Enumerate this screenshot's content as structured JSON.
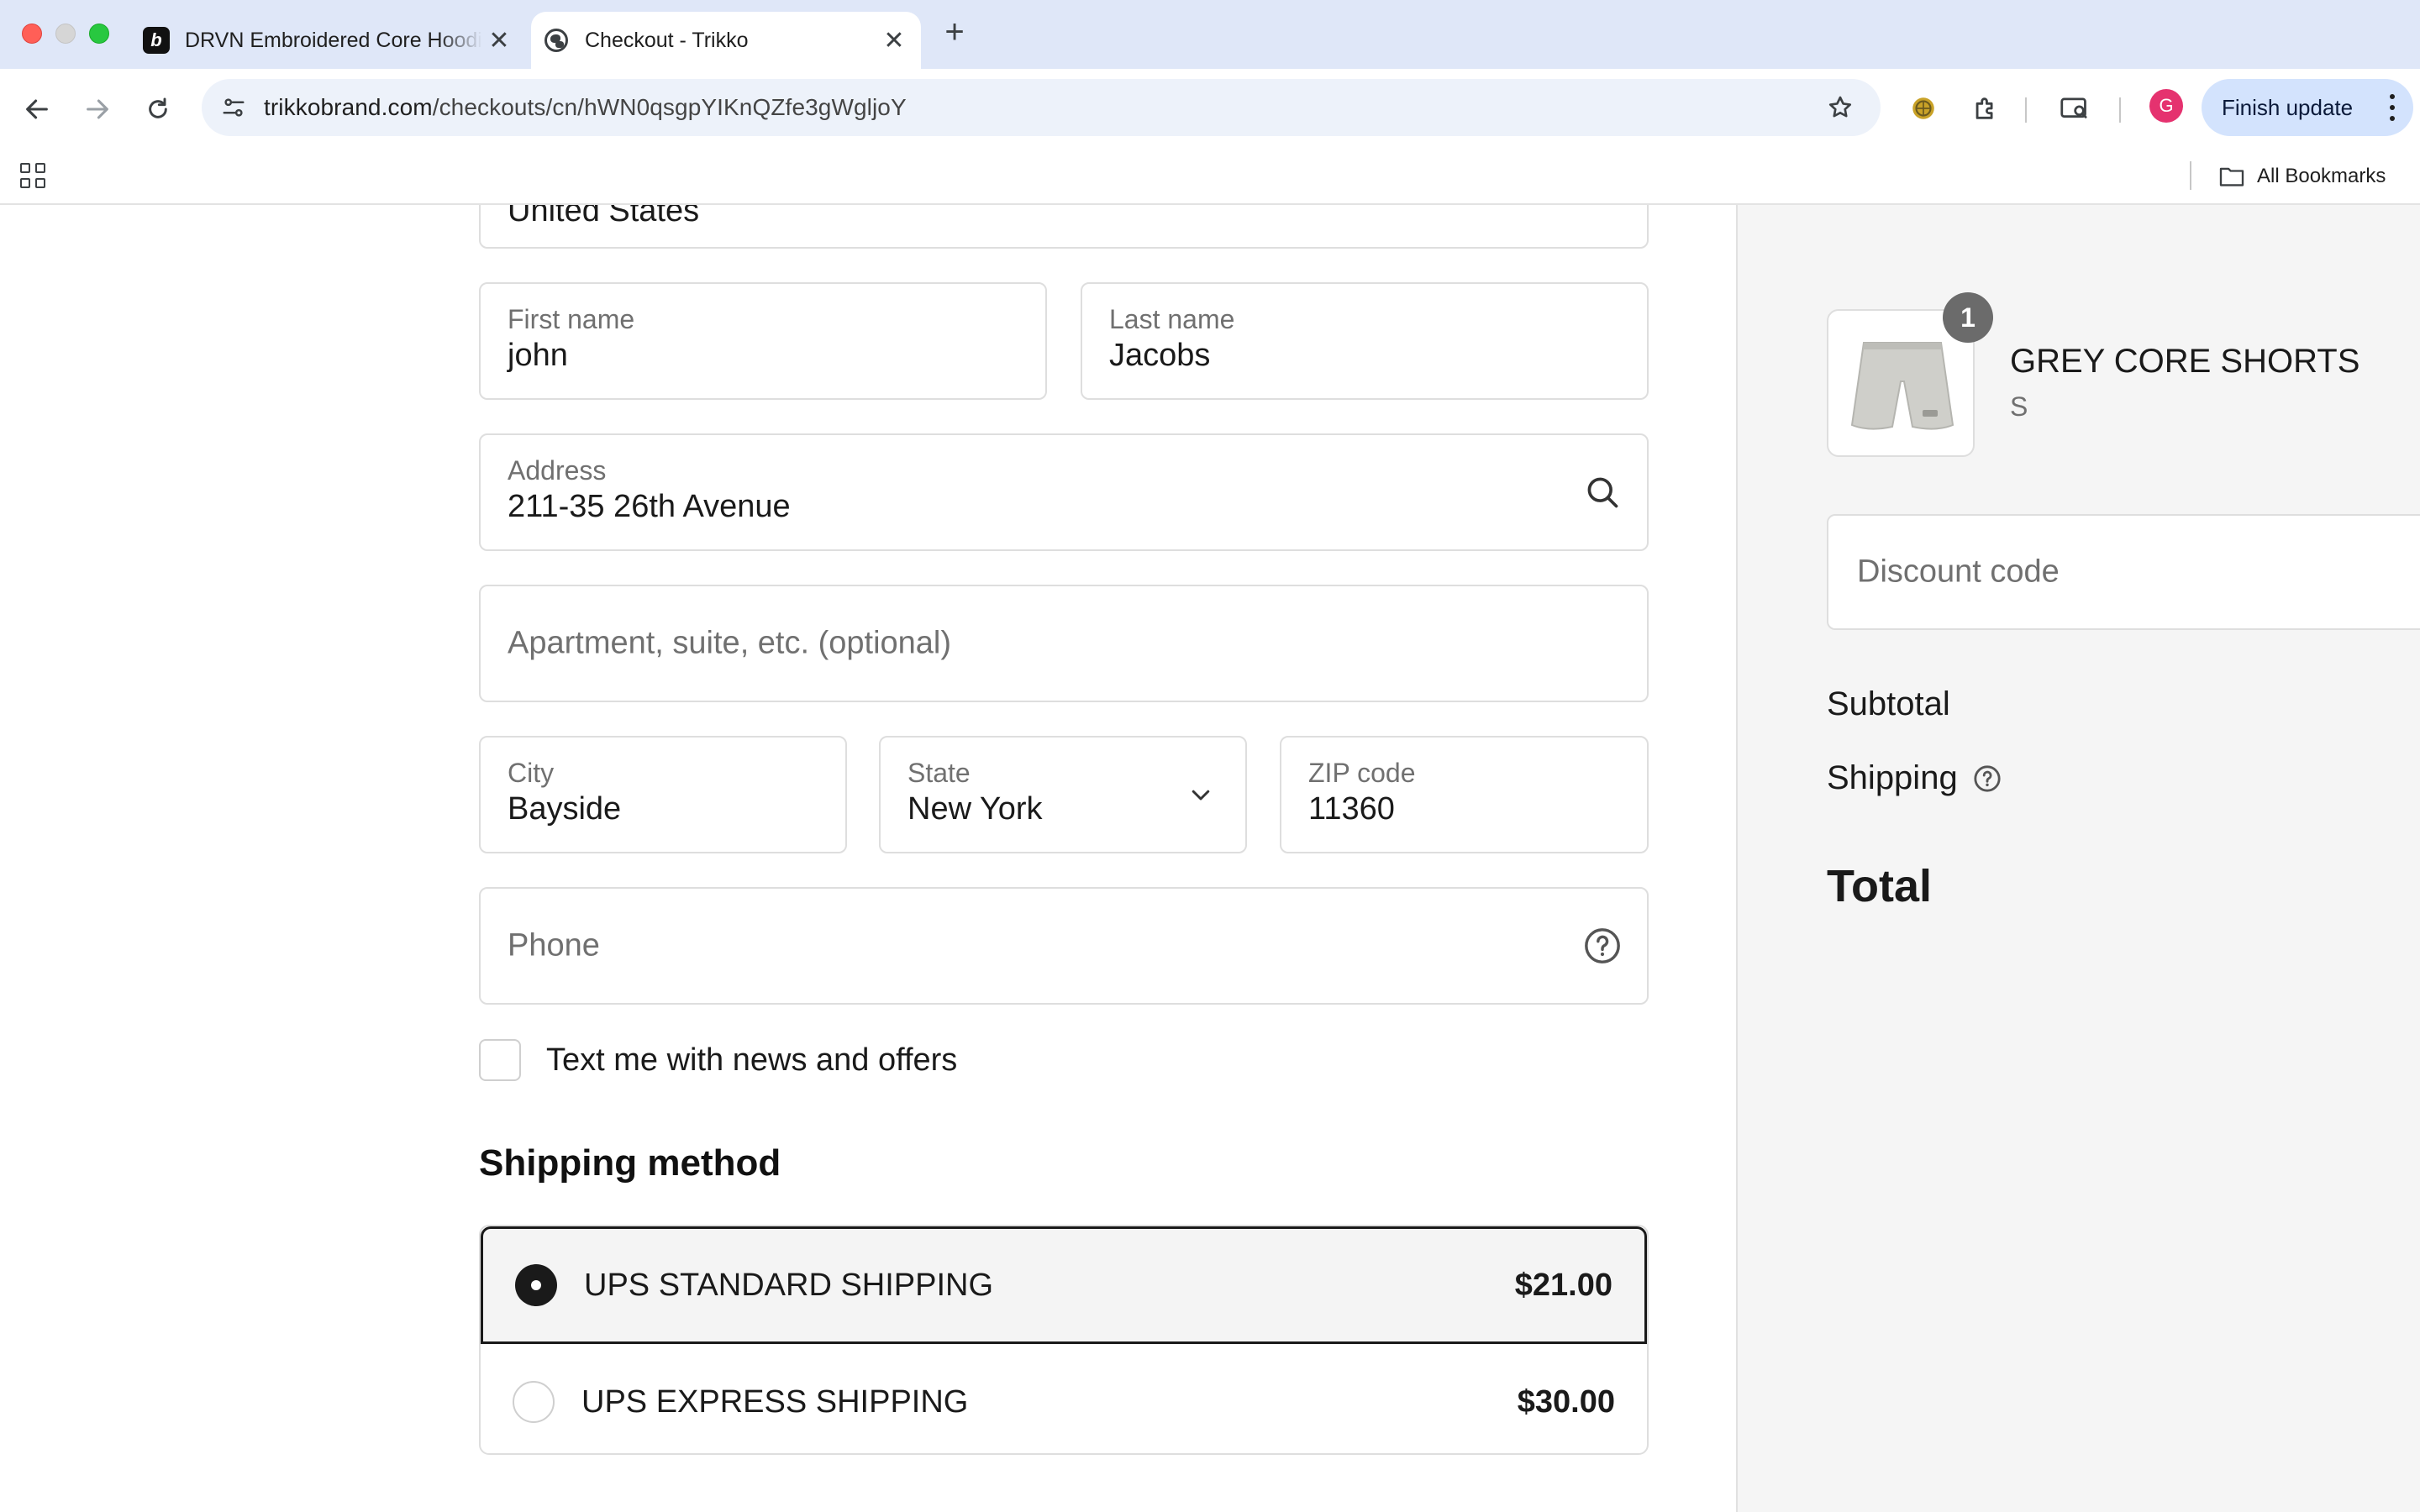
{
  "browser": {
    "tabs": [
      {
        "title": "DRVN Embroidered Core Hoodie",
        "favicon": "b-logo-icon"
      },
      {
        "title": "Checkout - Trikko",
        "favicon": "globe-icon"
      }
    ],
    "new_tab_label": "+",
    "url_host": "trikkobrand.com",
    "url_path": "/checkouts/cn/hWN0qsgpYIKnQZfe3gWgljoY",
    "profile_initial": "G",
    "finish_update_label": "Finish update",
    "all_bookmarks_label": "All Bookmarks"
  },
  "form": {
    "country_value": "United States",
    "first_name": {
      "label": "First name",
      "value": "john"
    },
    "last_name": {
      "label": "Last name",
      "value": "Jacobs"
    },
    "address": {
      "label": "Address",
      "value": "211-35 26th Avenue"
    },
    "apartment": {
      "placeholder": "Apartment, suite, etc. (optional)"
    },
    "city": {
      "label": "City",
      "value": "Bayside"
    },
    "state": {
      "label": "State",
      "value": "New York"
    },
    "zip": {
      "label": "ZIP code",
      "value": "11360"
    },
    "phone": {
      "placeholder": "Phone"
    },
    "sms_opt_in_label": "Text me with news and offers"
  },
  "shipping_method": {
    "title": "Shipping method",
    "options": [
      {
        "name": "UPS STANDARD SHIPPING",
        "price": "$21.00",
        "selected": true
      },
      {
        "name": "UPS EXPRESS SHIPPING",
        "price": "$30.00",
        "selected": false
      }
    ]
  },
  "summary": {
    "item": {
      "name": "GREY CORE SHORTS",
      "variant": "S",
      "quantity": "1"
    },
    "discount_placeholder": "Discount code",
    "subtotal_label": "Subtotal",
    "shipping_label": "Shipping",
    "total_label": "Total"
  },
  "colors": {
    "tabbar_bg": "#dfe7f8",
    "omnibox_bg": "#edf2fa",
    "finish_update_bg": "#d3e3fd",
    "sidebar_bg": "#f5f5f5",
    "selected_option_border": "#1a1a1a"
  }
}
